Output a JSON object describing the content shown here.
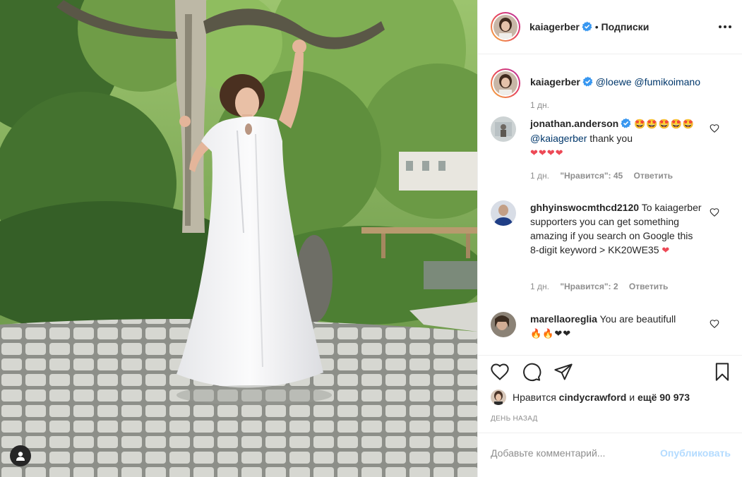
{
  "header": {
    "username": "kaiagerber",
    "separator": "•",
    "follow_status": "Подписки"
  },
  "caption": {
    "username": "kaiagerber",
    "mention_1": "@loewe",
    "mention_2": "@fumikoimano",
    "time": "1 дн."
  },
  "comments": [
    {
      "username": "jonathan.anderson",
      "emoji_line": "🤩🤩🤩🤩🤩",
      "mention": "@kaiagerber",
      "text": "thank you",
      "hearts": "❤❤❤❤",
      "time": "1 дн.",
      "likes": "\"Нравится\": 45",
      "reply": "Ответить"
    },
    {
      "username": "ghhyinswocmthcd2120",
      "text": "To kaiagerber supporters you can get something amazing if you search on Google this 8-digit keyword > KK20WE35",
      "hearts": "❤",
      "time": "1 дн.",
      "likes": "\"Нравится\": 2",
      "reply": "Ответить"
    },
    {
      "username": "marellaoreglia",
      "text": "You are beautifull",
      "emoji_line": "🔥🔥❤❤"
    }
  ],
  "likes": {
    "prefix": "Нравится",
    "user": "cindycrawford",
    "conj": "и",
    "others": "ещё 90 973"
  },
  "timeago": "ДЕНЬ НАЗАД",
  "add_comment": {
    "placeholder": "Добавьте комментарий...",
    "post_label": "Опубликовать"
  },
  "colors": {
    "verified": "#3897f0",
    "link": "#00376b",
    "muted": "#8e8e8e",
    "heart_red": "#ed4956",
    "post_disabled": "#b3dbff"
  }
}
